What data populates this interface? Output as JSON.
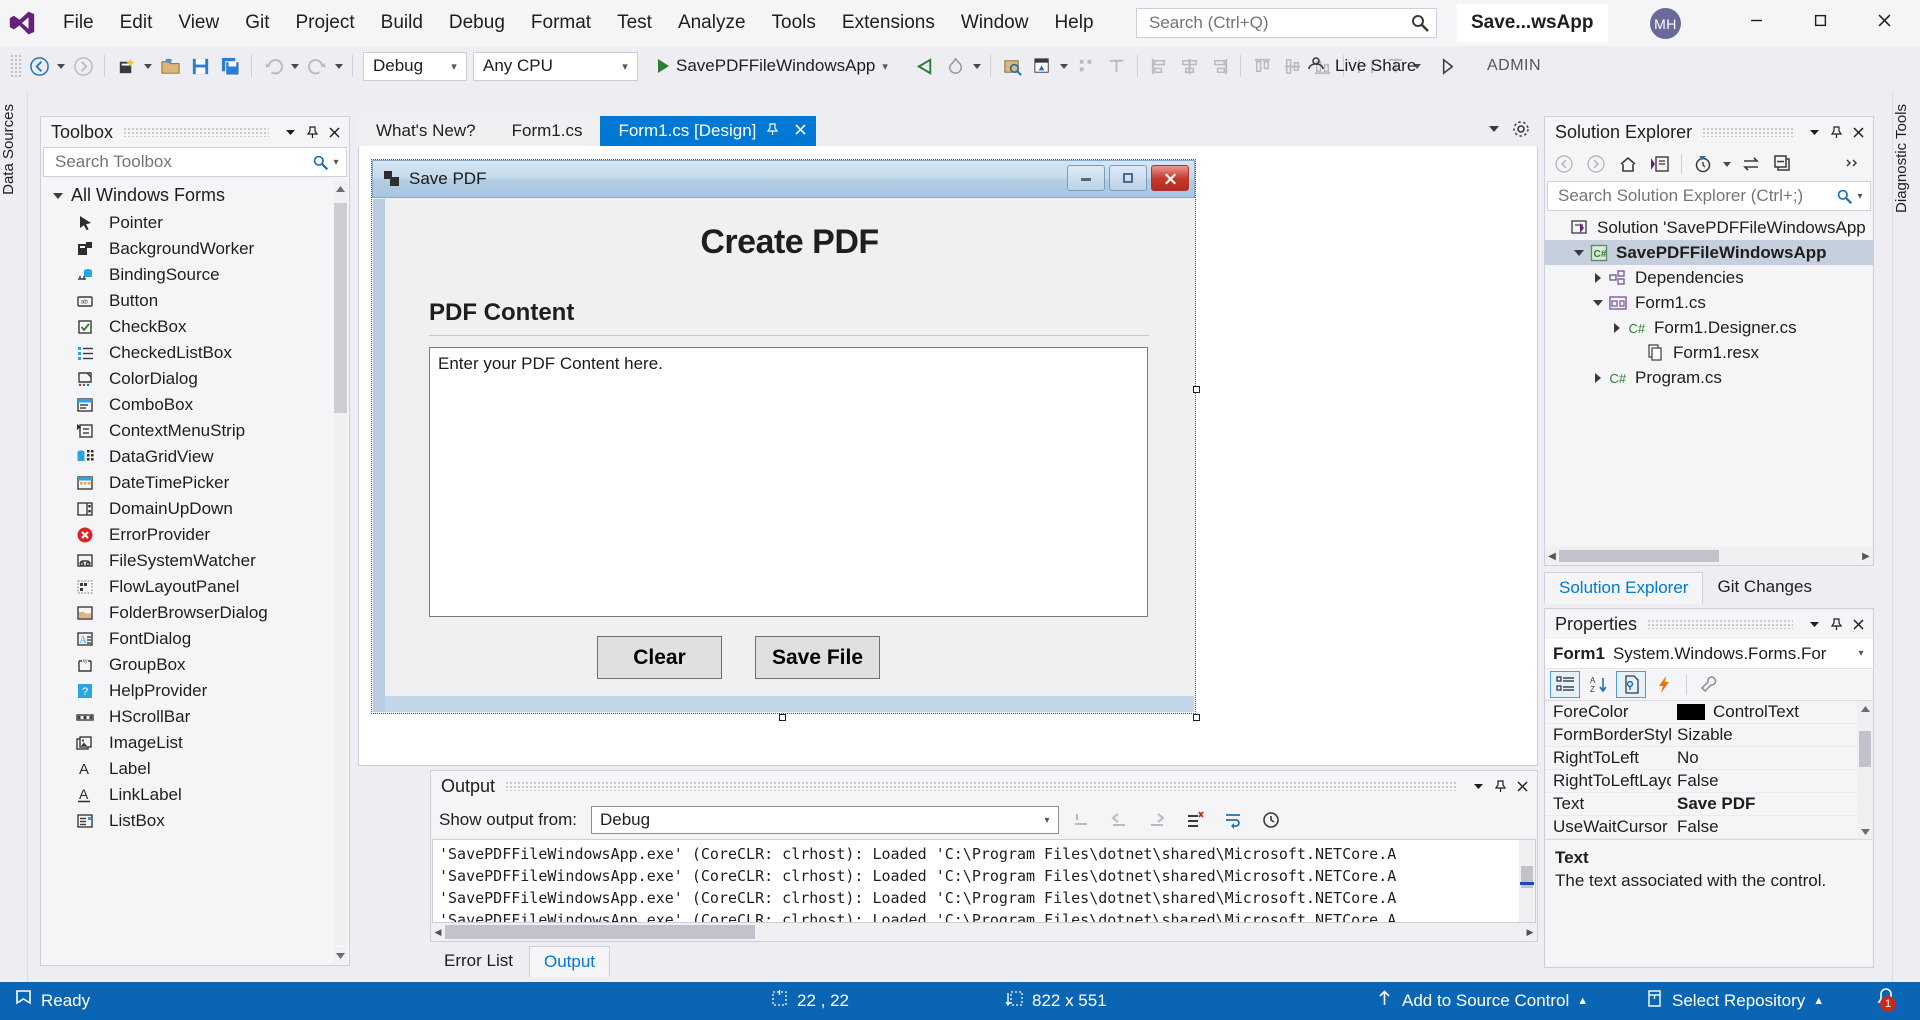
{
  "titlebar": {
    "menus": [
      "File",
      "Edit",
      "View",
      "Git",
      "Project",
      "Build",
      "Debug",
      "Format",
      "Test",
      "Analyze",
      "Tools",
      "Extensions",
      "Window",
      "Help"
    ],
    "search_placeholder": "Search (Ctrl+Q)",
    "app_chip": "Save...wsApp",
    "avatar_initials": "MH"
  },
  "toolbar": {
    "configuration": "Debug",
    "platform": "Any CPU",
    "run_target": "SavePDFFileWindowsApp",
    "live_share": "Live Share",
    "admin": "ADMIN"
  },
  "rails": {
    "left_label": "Data Sources",
    "right_label": "Diagnostic Tools"
  },
  "toolbox": {
    "title": "Toolbox",
    "search_placeholder": "Search Toolbox",
    "group": "All Windows Forms",
    "items": [
      {
        "label": "Pointer",
        "icon": "pointer-icon"
      },
      {
        "label": "BackgroundWorker",
        "icon": "backgroundworker-icon"
      },
      {
        "label": "BindingSource",
        "icon": "bindingsource-icon"
      },
      {
        "label": "Button",
        "icon": "button-icon"
      },
      {
        "label": "CheckBox",
        "icon": "checkbox-icon"
      },
      {
        "label": "CheckedListBox",
        "icon": "checkedlistbox-icon"
      },
      {
        "label": "ColorDialog",
        "icon": "colordialog-icon"
      },
      {
        "label": "ComboBox",
        "icon": "combobox-icon"
      },
      {
        "label": "ContextMenuStrip",
        "icon": "contextmenustrip-icon"
      },
      {
        "label": "DataGridView",
        "icon": "datagridview-icon"
      },
      {
        "label": "DateTimePicker",
        "icon": "datetimepicker-icon"
      },
      {
        "label": "DomainUpDown",
        "icon": "domainupdown-icon"
      },
      {
        "label": "ErrorProvider",
        "icon": "errorprovider-icon"
      },
      {
        "label": "FileSystemWatcher",
        "icon": "filesystemwatcher-icon"
      },
      {
        "label": "FlowLayoutPanel",
        "icon": "flowlayoutpanel-icon"
      },
      {
        "label": "FolderBrowserDialog",
        "icon": "folderbrowserdialog-icon"
      },
      {
        "label": "FontDialog",
        "icon": "fontdialog-icon"
      },
      {
        "label": "GroupBox",
        "icon": "groupbox-icon"
      },
      {
        "label": "HelpProvider",
        "icon": "helpprovider-icon"
      },
      {
        "label": "HScrollBar",
        "icon": "hscrollbar-icon"
      },
      {
        "label": "ImageList",
        "icon": "imagelist-icon"
      },
      {
        "label": "Label",
        "icon": "label-icon"
      },
      {
        "label": "LinkLabel",
        "icon": "linklabel-icon"
      },
      {
        "label": "ListBox",
        "icon": "listbox-icon"
      }
    ]
  },
  "doc_tabs": [
    {
      "label": "What's New?",
      "state": "inactive"
    },
    {
      "label": "Form1.cs",
      "state": "inactive"
    },
    {
      "label": "Form1.cs [Design]",
      "state": "active"
    }
  ],
  "winform": {
    "title": "Save PDF",
    "heading": "Create PDF",
    "groupbox_label": "PDF Content",
    "textarea_value": "Enter your PDF Content here.",
    "clear_button": "Clear",
    "save_button": "Save File"
  },
  "output": {
    "title": "Output",
    "show_from_label": "Show output from:",
    "source": "Debug",
    "lines": [
      "'SavePDFFileWindowsApp.exe' (CoreCLR: clrhost): Loaded 'C:\\Program Files\\dotnet\\shared\\Microsoft.NETCore.A",
      "'SavePDFFileWindowsApp.exe' (CoreCLR: clrhost): Loaded 'C:\\Program Files\\dotnet\\shared\\Microsoft.NETCore.A",
      "'SavePDFFileWindowsApp.exe' (CoreCLR: clrhost): Loaded 'C:\\Program Files\\dotnet\\shared\\Microsoft.NETCore.A",
      "'SavePDFFileWindowsApp.exe' (CoreCLR: clrhost): Loaded 'C:\\Program Files\\dotnet\\shared\\Microsoft.NETCore.A"
    ]
  },
  "bottom_tabs": [
    {
      "label": "Error List",
      "active": false
    },
    {
      "label": "Output",
      "active": true
    }
  ],
  "solution_explorer": {
    "title": "Solution Explorer",
    "search_placeholder": "Search Solution Explorer (Ctrl+;)",
    "tree": [
      {
        "label": "Solution 'SavePDFFileWindowsApp",
        "indent": 0,
        "expander": "none",
        "icon": "solution-icon",
        "selected": false
      },
      {
        "label": "SavePDFFileWindowsApp",
        "indent": 1,
        "expander": "down",
        "icon": "csproj-icon",
        "selected": true
      },
      {
        "label": "Dependencies",
        "indent": 2,
        "expander": "right",
        "icon": "dependencies-icon",
        "selected": false
      },
      {
        "label": "Form1.cs",
        "indent": 2,
        "expander": "down",
        "icon": "form-icon",
        "selected": false
      },
      {
        "label": "Form1.Designer.cs",
        "indent": 3,
        "expander": "right",
        "icon": "csharp-icon",
        "selected": false
      },
      {
        "label": "Form1.resx",
        "indent": 4,
        "expander": "none",
        "icon": "resx-icon",
        "selected": false
      },
      {
        "label": "Program.cs",
        "indent": 2,
        "expander": "right",
        "icon": "csharp-icon",
        "selected": false
      }
    ],
    "tabs": [
      {
        "label": "Solution Explorer",
        "active": true
      },
      {
        "label": "Git Changes",
        "active": false
      }
    ]
  },
  "properties": {
    "title": "Properties",
    "object_name": "Form1",
    "object_type": "System.Windows.Forms.For",
    "rows": [
      {
        "key": "ForeColor",
        "value": "ControlText",
        "swatch": "#000000",
        "bold": false
      },
      {
        "key": "FormBorderStyle",
        "value": "Sizable",
        "swatch": null,
        "bold": false
      },
      {
        "key": "RightToLeft",
        "value": "No",
        "swatch": null,
        "bold": false
      },
      {
        "key": "RightToLeftLayo",
        "value": "False",
        "swatch": null,
        "bold": false
      },
      {
        "key": "Text",
        "value": "Save PDF",
        "swatch": null,
        "bold": true
      },
      {
        "key": "UseWaitCursor",
        "value": "False",
        "swatch": null,
        "bold": false
      }
    ],
    "desc_title": "Text",
    "desc_body": "The text associated with the control."
  },
  "statusbar": {
    "ready": "Ready",
    "cursor_position": "22 , 22",
    "size": "822 x 551",
    "source_control": "Add to Source Control",
    "repository": "Select Repository",
    "notification_count": "1"
  },
  "colors": {
    "accent": "#0078d4",
    "statusbar": "#0a65b5",
    "tab_active": "#0078d4",
    "selection": "#c6cfdd"
  }
}
